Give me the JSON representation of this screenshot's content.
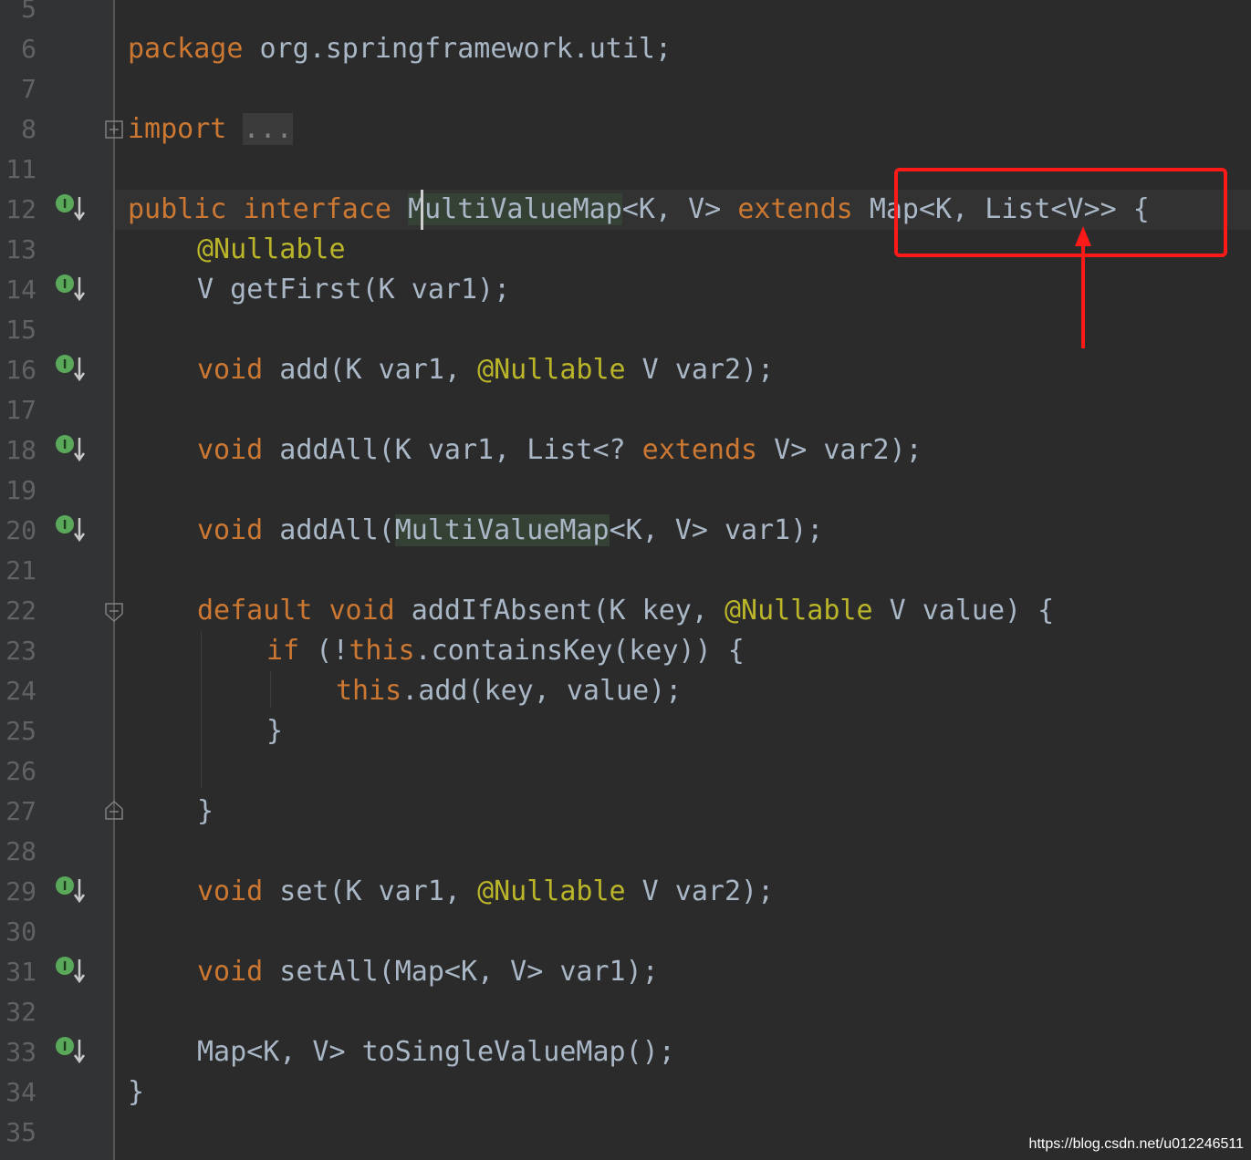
{
  "editor": {
    "line_numbers": [
      "5",
      "6",
      "7",
      "8",
      "11",
      "12",
      "13",
      "14",
      "15",
      "16",
      "17",
      "18",
      "19",
      "20",
      "21",
      "22",
      "23",
      "24",
      "25",
      "26",
      "27",
      "28",
      "29",
      "30",
      "31",
      "32",
      "33",
      "34",
      "35"
    ],
    "code": {
      "l6": {
        "kw": "package",
        "rest": " org.springframework.util;"
      },
      "l8": {
        "kw": "import",
        "folded": "..."
      },
      "l12": {
        "kw1": "public",
        "kw2": "interface",
        "name": "MultiValueMap",
        "gen": "<K, V>",
        "ext": "extends",
        "rest": "Map<K, List<V>> {"
      },
      "l13": {
        "ann": "@Nullable"
      },
      "l14": {
        "rest": "V getFirst(K var1);"
      },
      "l16": {
        "kw": "void",
        "a": " add(K var1, ",
        "ann": "@Nullable",
        "b": " V var2);"
      },
      "l18": {
        "kw": "void",
        "a": " addAll(K var1, List<? ",
        "ext": "extends",
        "b": " V> var2);"
      },
      "l20": {
        "kw": "void",
        "a": " addAll(",
        "hl": "MultiValueMap",
        "b": "<K, V> var1);"
      },
      "l22": {
        "kw1": "default",
        "kw2": "void",
        "a": " addIfAbsent(K key, ",
        "ann": "@Nullable",
        "b": " V value) {"
      },
      "l23": {
        "kw": "if",
        "a": " (!",
        "this": "this",
        "b": ".containsKey(key)) {"
      },
      "l24": {
        "this": "this",
        "a": ".add(key, value);"
      },
      "l25": {
        "a": "}"
      },
      "l27": {
        "a": "}"
      },
      "l29": {
        "kw": "void",
        "a": " set(K var1, ",
        "ann": "@Nullable",
        "b": " V var2);"
      },
      "l31": {
        "kw": "void",
        "a": " setAll(Map<K, V> var1);"
      },
      "l33": {
        "a": "Map<K, V> toSingleValueMap();"
      },
      "l34": {
        "a": "}"
      }
    }
  },
  "watermark": "https://blog.csdn.net/u012246511",
  "colors": {
    "keyword": "#cc7832",
    "annotation": "#bbb529",
    "text": "#a9b7c6",
    "highlight_box": "#ff1a1a"
  }
}
